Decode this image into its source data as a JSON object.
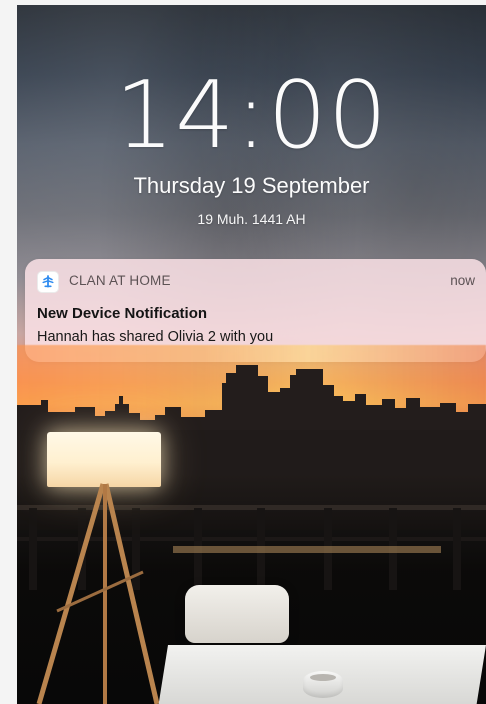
{
  "lock_screen": {
    "time": "14:00",
    "date": "Thursday 19 September",
    "hijri_date": "19 Muh. 1441 AH"
  },
  "notification": {
    "app_icon": "clan-at-home-icon",
    "app_name": "CLAN AT HOME",
    "time": "now",
    "title": "New Device Notification",
    "body": "Hannah has shared Olivia 2 with you"
  },
  "colors": {
    "notification_background": "#FAE1E5",
    "time_text": "#FFFFFF",
    "app_icon_blue": "#2F8BEF"
  }
}
